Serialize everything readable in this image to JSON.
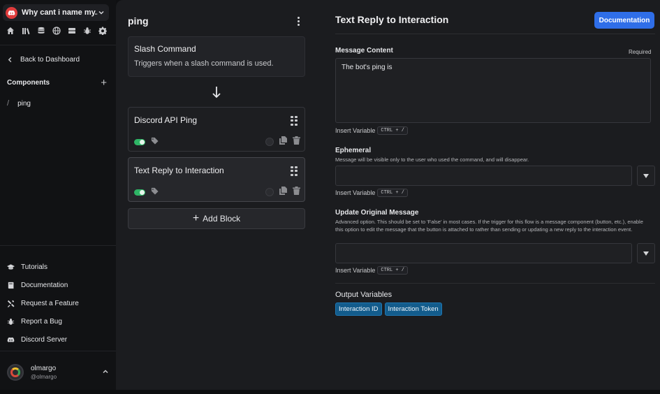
{
  "sidebar": {
    "server_name": "Why cant i name my...",
    "nav_icons": [
      "home-icon",
      "library-icon",
      "database-icon",
      "globe-icon",
      "server-icon",
      "bug-icon",
      "gear-icon"
    ],
    "back_label": "Back to Dashboard",
    "components_label": "Components",
    "components": [
      {
        "label": "ping"
      }
    ],
    "links": [
      {
        "label": "Tutorials",
        "icon": "graduation-cap-icon"
      },
      {
        "label": "Documentation",
        "icon": "book-icon"
      },
      {
        "label": "Request a Feature",
        "icon": "tools-icon"
      },
      {
        "label": "Report a Bug",
        "icon": "bug-icon"
      },
      {
        "label": "Discord Server",
        "icon": "discord-icon"
      }
    ],
    "user": {
      "name": "olmargo",
      "handle": "@olmargo"
    }
  },
  "flow": {
    "title": "ping",
    "trigger": {
      "title": "Slash Command",
      "description": "Triggers when a slash command is used."
    },
    "blocks": [
      {
        "title": "Discord API Ping",
        "enabled": true
      },
      {
        "title": "Text Reply to Interaction",
        "enabled": true
      }
    ],
    "add_block_label": "Add Block"
  },
  "panel": {
    "title": "Text Reply to Interaction",
    "doc_button": "Documentation",
    "message_content": {
      "label": "Message Content",
      "required": "Required",
      "value": "The bot's ping is"
    },
    "insert_variable": {
      "label": "Insert Variable",
      "shortcut": "CTRL + /"
    },
    "ephemeral": {
      "label": "Ephemeral",
      "description": "Message will be visible only to the user who used the command, and will disappear."
    },
    "update_original": {
      "label": "Update Original Message",
      "description": "Advanced option. This should be set to 'False' in most cases. If the trigger for this flow is a message component (button, etc.), enable this option to edit the message that the button is attached to rather than sending or updating a new reply to the interaction event."
    },
    "output_variables": {
      "label": "Output Variables",
      "items": [
        "Interaction ID",
        "Interaction Token"
      ]
    }
  },
  "colors": {
    "accent": "#2f6ee8",
    "toggle_on": "#2fb566",
    "chip": "#135c8c",
    "server_logo": "#e03c3c"
  }
}
